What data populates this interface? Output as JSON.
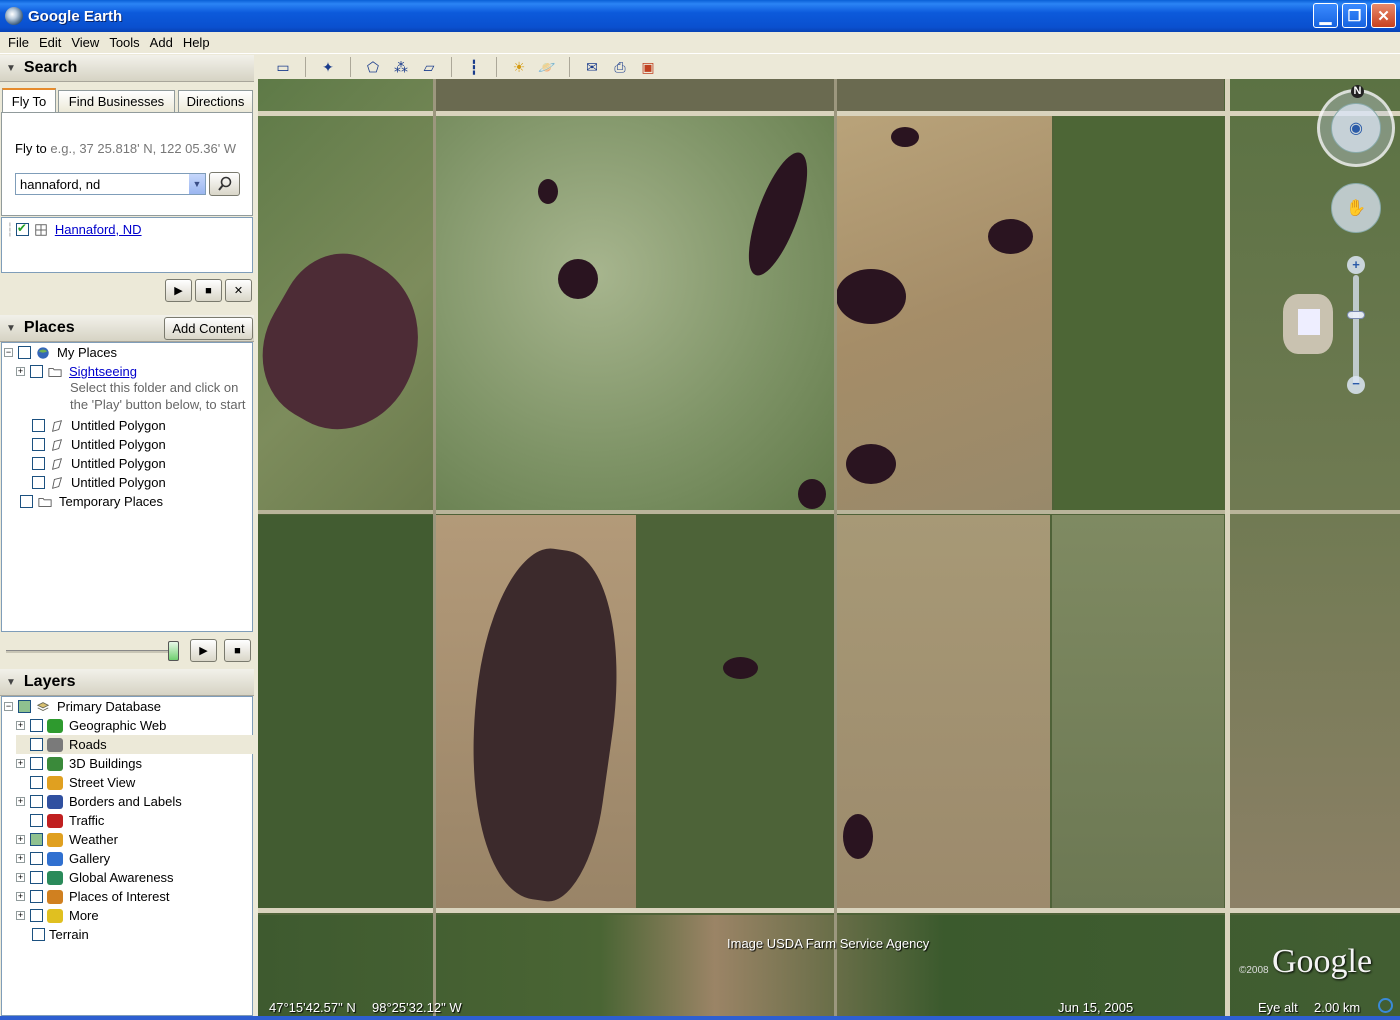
{
  "window": {
    "title": "Google Earth"
  },
  "menu": [
    "File",
    "Edit",
    "View",
    "Tools",
    "Add",
    "Help"
  ],
  "search": {
    "header": "Search",
    "tabs": [
      "Fly To",
      "Find Businesses",
      "Directions"
    ],
    "flyto_label": "Fly to",
    "flyto_example": "e.g., 37 25.818' N, 122 05.36' W",
    "query": "hannaford, nd",
    "result": "Hannaford, ND"
  },
  "places": {
    "header": "Places",
    "add_content": "Add Content",
    "my_places": "My Places",
    "sightseeing": "Sightseeing",
    "sightseeing_hint_1": "Select this folder and click on",
    "sightseeing_hint_2": "the 'Play' button below, to start",
    "polygons": [
      "Untitled Polygon",
      "Untitled Polygon",
      "Untitled Polygon",
      "Untitled Polygon"
    ],
    "temporary": "Temporary Places"
  },
  "layers": {
    "header": "Layers",
    "primary": "Primary Database",
    "items": [
      {
        "label": "Geographic Web",
        "icon": "star-icon",
        "color": "#2e9a2e",
        "expander": true
      },
      {
        "label": "Roads",
        "icon": "road-icon",
        "color": "#7a7a7a",
        "expander": false
      },
      {
        "label": "3D Buildings",
        "icon": "building-icon",
        "color": "#3a8a3a",
        "expander": true
      },
      {
        "label": "Street View",
        "icon": "person-icon",
        "color": "#e0a020",
        "expander": false
      },
      {
        "label": "Borders and Labels",
        "icon": "flag-icon",
        "color": "#3050a0",
        "expander": true
      },
      {
        "label": "Traffic",
        "icon": "traffic-light-icon",
        "color": "#c02020",
        "expander": false
      },
      {
        "label": "Weather",
        "icon": "sun-icon",
        "color": "#e0a020",
        "expander": true
      },
      {
        "label": "Gallery",
        "icon": "star-icon",
        "color": "#3070d0",
        "expander": true
      },
      {
        "label": "Global Awareness",
        "icon": "globe-icon",
        "color": "#2a8a5a",
        "expander": true
      },
      {
        "label": "Places of Interest",
        "icon": "pin-flag-icon",
        "color": "#d08020",
        "expander": true
      },
      {
        "label": "More",
        "icon": "note-icon",
        "color": "#e0c020",
        "expander": true
      }
    ],
    "terrain": "Terrain"
  },
  "map": {
    "attribution": "Image USDA Farm Service Agency",
    "copyright_year": "©2008",
    "logo": "Google",
    "compass_north": "N",
    "lat": "47°15'42.57\" N",
    "lon": "98°25'32.12\" W",
    "date": "Jun 15, 2005",
    "eye_alt_label": "Eye alt",
    "eye_alt": "2.00 km",
    "zoom_level": 0.35
  },
  "colors": {
    "titlebar": "#0A50CF",
    "accent_tab": "#e68b2c",
    "link": "#0000cc"
  }
}
